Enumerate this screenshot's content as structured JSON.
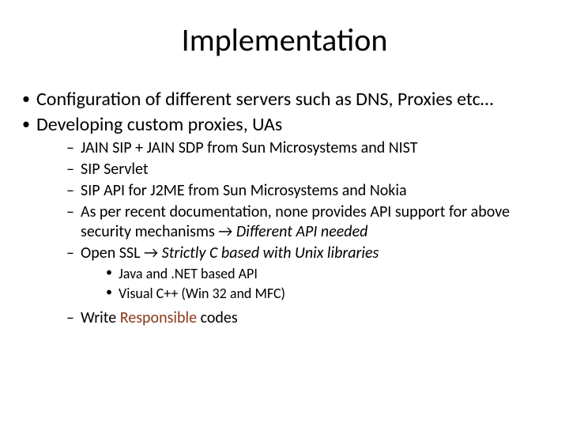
{
  "title": "Implementation",
  "l1": {
    "i0": "Configuration of different servers such as DNS, Proxies etc…",
    "i1": "Developing custom proxies, UAs"
  },
  "l2a": {
    "i0": "JAIN SIP + JAIN SDP from Sun Microsystems and NIST",
    "i1": "SIP Servlet",
    "i2": "SIP API for J2ME from Sun Microsystems and Nokia",
    "i3_a": "As per recent documentation, none provides API support for above security mechanisms ",
    "i3_arrow": "→",
    "i3_b": " Different API needed",
    "i4_a": "Open SSL ",
    "i4_arrow": "→",
    "i4_b": " Strictly C based with Unix libraries"
  },
  "l3": {
    "i0": "Java and .NET based API",
    "i1": "Visual C++ (Win 32 and MFC)"
  },
  "l2b": {
    "i0_a": "Write ",
    "i0_b": "Responsible",
    "i0_c": " codes"
  }
}
